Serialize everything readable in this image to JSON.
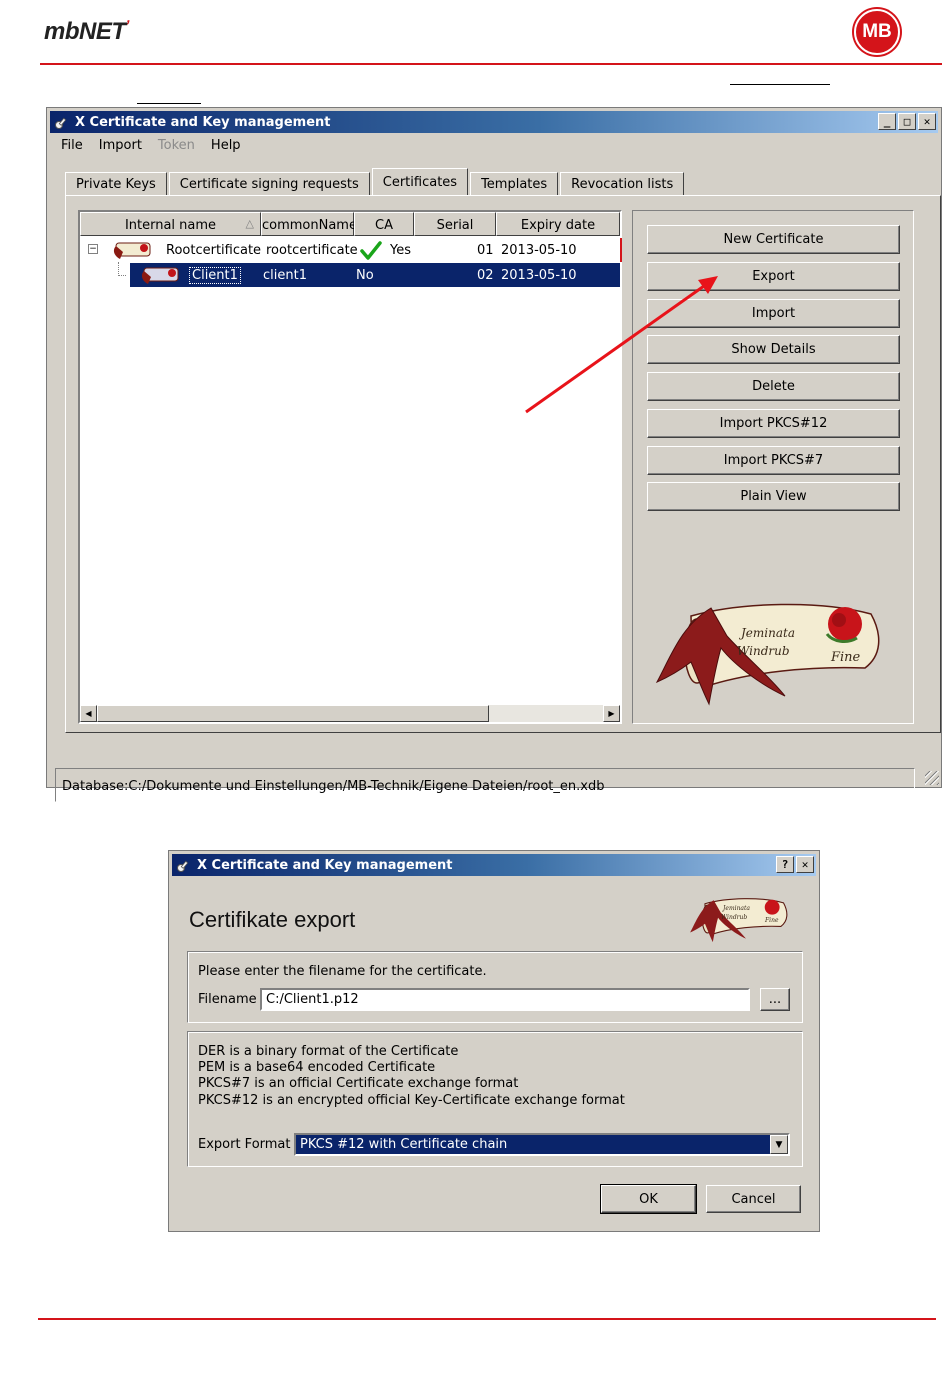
{
  "header": {
    "brand": "mbNET",
    "brand_tick": "ʼ",
    "logo_text": "MB"
  },
  "colors": {
    "accent_red": "#d4141a",
    "title_blue": "#0a246a",
    "window_gray": "#d4d0c8",
    "arrow_red": "#e8131a"
  },
  "main_window": {
    "title": "X Certificate and Key management",
    "menu": [
      {
        "label": "File",
        "enabled": true
      },
      {
        "label": "Import",
        "enabled": true
      },
      {
        "label": "Token",
        "enabled": false
      },
      {
        "label": "Help",
        "enabled": true
      }
    ],
    "tabs": [
      {
        "label": "Private Keys"
      },
      {
        "label": "Certificate signing requests"
      },
      {
        "label": "Certificates",
        "active": true
      },
      {
        "label": "Templates"
      },
      {
        "label": "Revocation lists"
      }
    ],
    "columns": [
      "Internal name",
      "commonName",
      "CA",
      "Serial",
      "Expiry date"
    ],
    "rows": [
      {
        "internal_name": "Rootcertificate",
        "common_name": "rootcertificate",
        "ca": "Yes",
        "serial": "01",
        "expiry": "2013-05-10",
        "selected": false
      },
      {
        "internal_name": "Client1",
        "common_name": "client1",
        "ca": "No",
        "serial": "02",
        "expiry": "2013-05-10",
        "selected": true
      }
    ],
    "buttons": [
      "New Certificate",
      "Export",
      "Import",
      "Show Details",
      "Delete",
      "Import PKCS#12",
      "Import PKCS#7",
      "Plain View"
    ],
    "status": "Database:C:/Dokumente und Einstellungen/MB-Technik/Eigene Dateien/root_en.xdb",
    "logo_lines": [
      "Jeminata",
      "Windrub",
      "Fine"
    ]
  },
  "export_dialog": {
    "title": "X Certificate and Key management",
    "heading": "Certifikate export",
    "filename_prompt": "Please enter the filename for the certificate.",
    "filename_label": "Filename",
    "filename_value": "C:/Client1.p12",
    "browse_label": "...",
    "format_lines": [
      "DER is a binary format of the Certificate",
      "PEM is a base64 encoded Certificate",
      "PKCS#7 is an official Certificate exchange format",
      "PKCS#12 is an encrypted official Key-Certificate exchange format"
    ],
    "export_format_label": "Export Format",
    "export_format_value": "PKCS #12 with Certificate chain",
    "ok_label": "OK",
    "cancel_label": "Cancel",
    "logo_lines": [
      "Jeminata",
      "Windrub",
      "Fine"
    ]
  }
}
